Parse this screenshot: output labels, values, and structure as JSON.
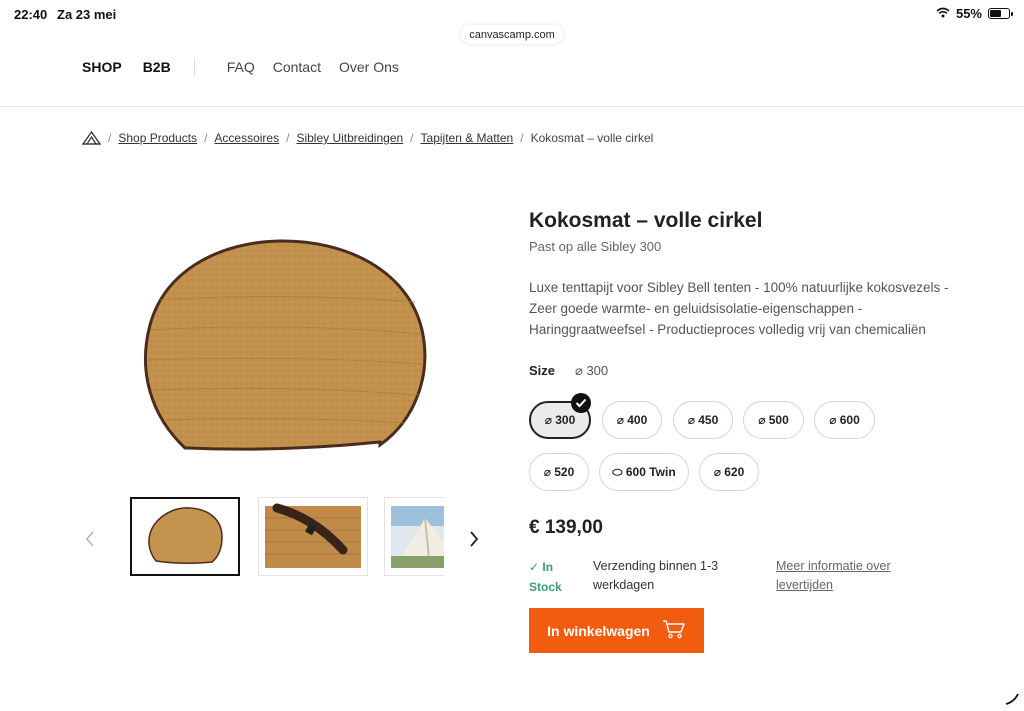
{
  "status_bar": {
    "time": "22:40",
    "date": "Za 23 mei",
    "battery": "55%",
    "battery_level": 0.55
  },
  "browser": {
    "url": "canvascamp.com"
  },
  "nav": {
    "primary": [
      "SHOP",
      "B2B"
    ],
    "secondary": [
      "FAQ",
      "Contact",
      "Over Ons"
    ]
  },
  "breadcrumb": {
    "links": [
      "Shop Products",
      "Accessoires",
      "Sibley Uitbreidingen",
      "Tapijten & Matten"
    ],
    "current": "Kokosmat – volle cirkel"
  },
  "product": {
    "title": "Kokosmat – volle cirkel",
    "subtitle": "Past op alle Sibley 300",
    "description": "Luxe tenttapijt voor Sibley Bell tenten - 100% natuurlijke kokosvezels - Zeer goede warmte- en geluidsisolatie-eigenschappen - Haringgraatweefsel - Productieproces volledig vrij van chemicaliën",
    "size_label": "Size",
    "selected_size": "⌀ 300",
    "size_options": [
      "⌀ 300",
      "⌀ 400",
      "⌀ 450",
      "⌀ 500",
      "⌀ 600",
      "⌀ 520",
      "⬭ 600 Twin",
      "⌀ 620"
    ],
    "price": "€ 139,00",
    "stock_line1": "In",
    "stock_line2": "Stock",
    "shipping_line1": "Verzending binnen 1-3",
    "shipping_line2": "werkdagen",
    "more_info_line1": "Meer informatie over",
    "more_info_line2": "levertijden",
    "cart_button": "In winkelwagen"
  },
  "colors": {
    "accent": "#f25c0e",
    "stock_green": "#3e9b6a",
    "mat": "#c4944f",
    "mat_border": "#4a2c1e"
  }
}
